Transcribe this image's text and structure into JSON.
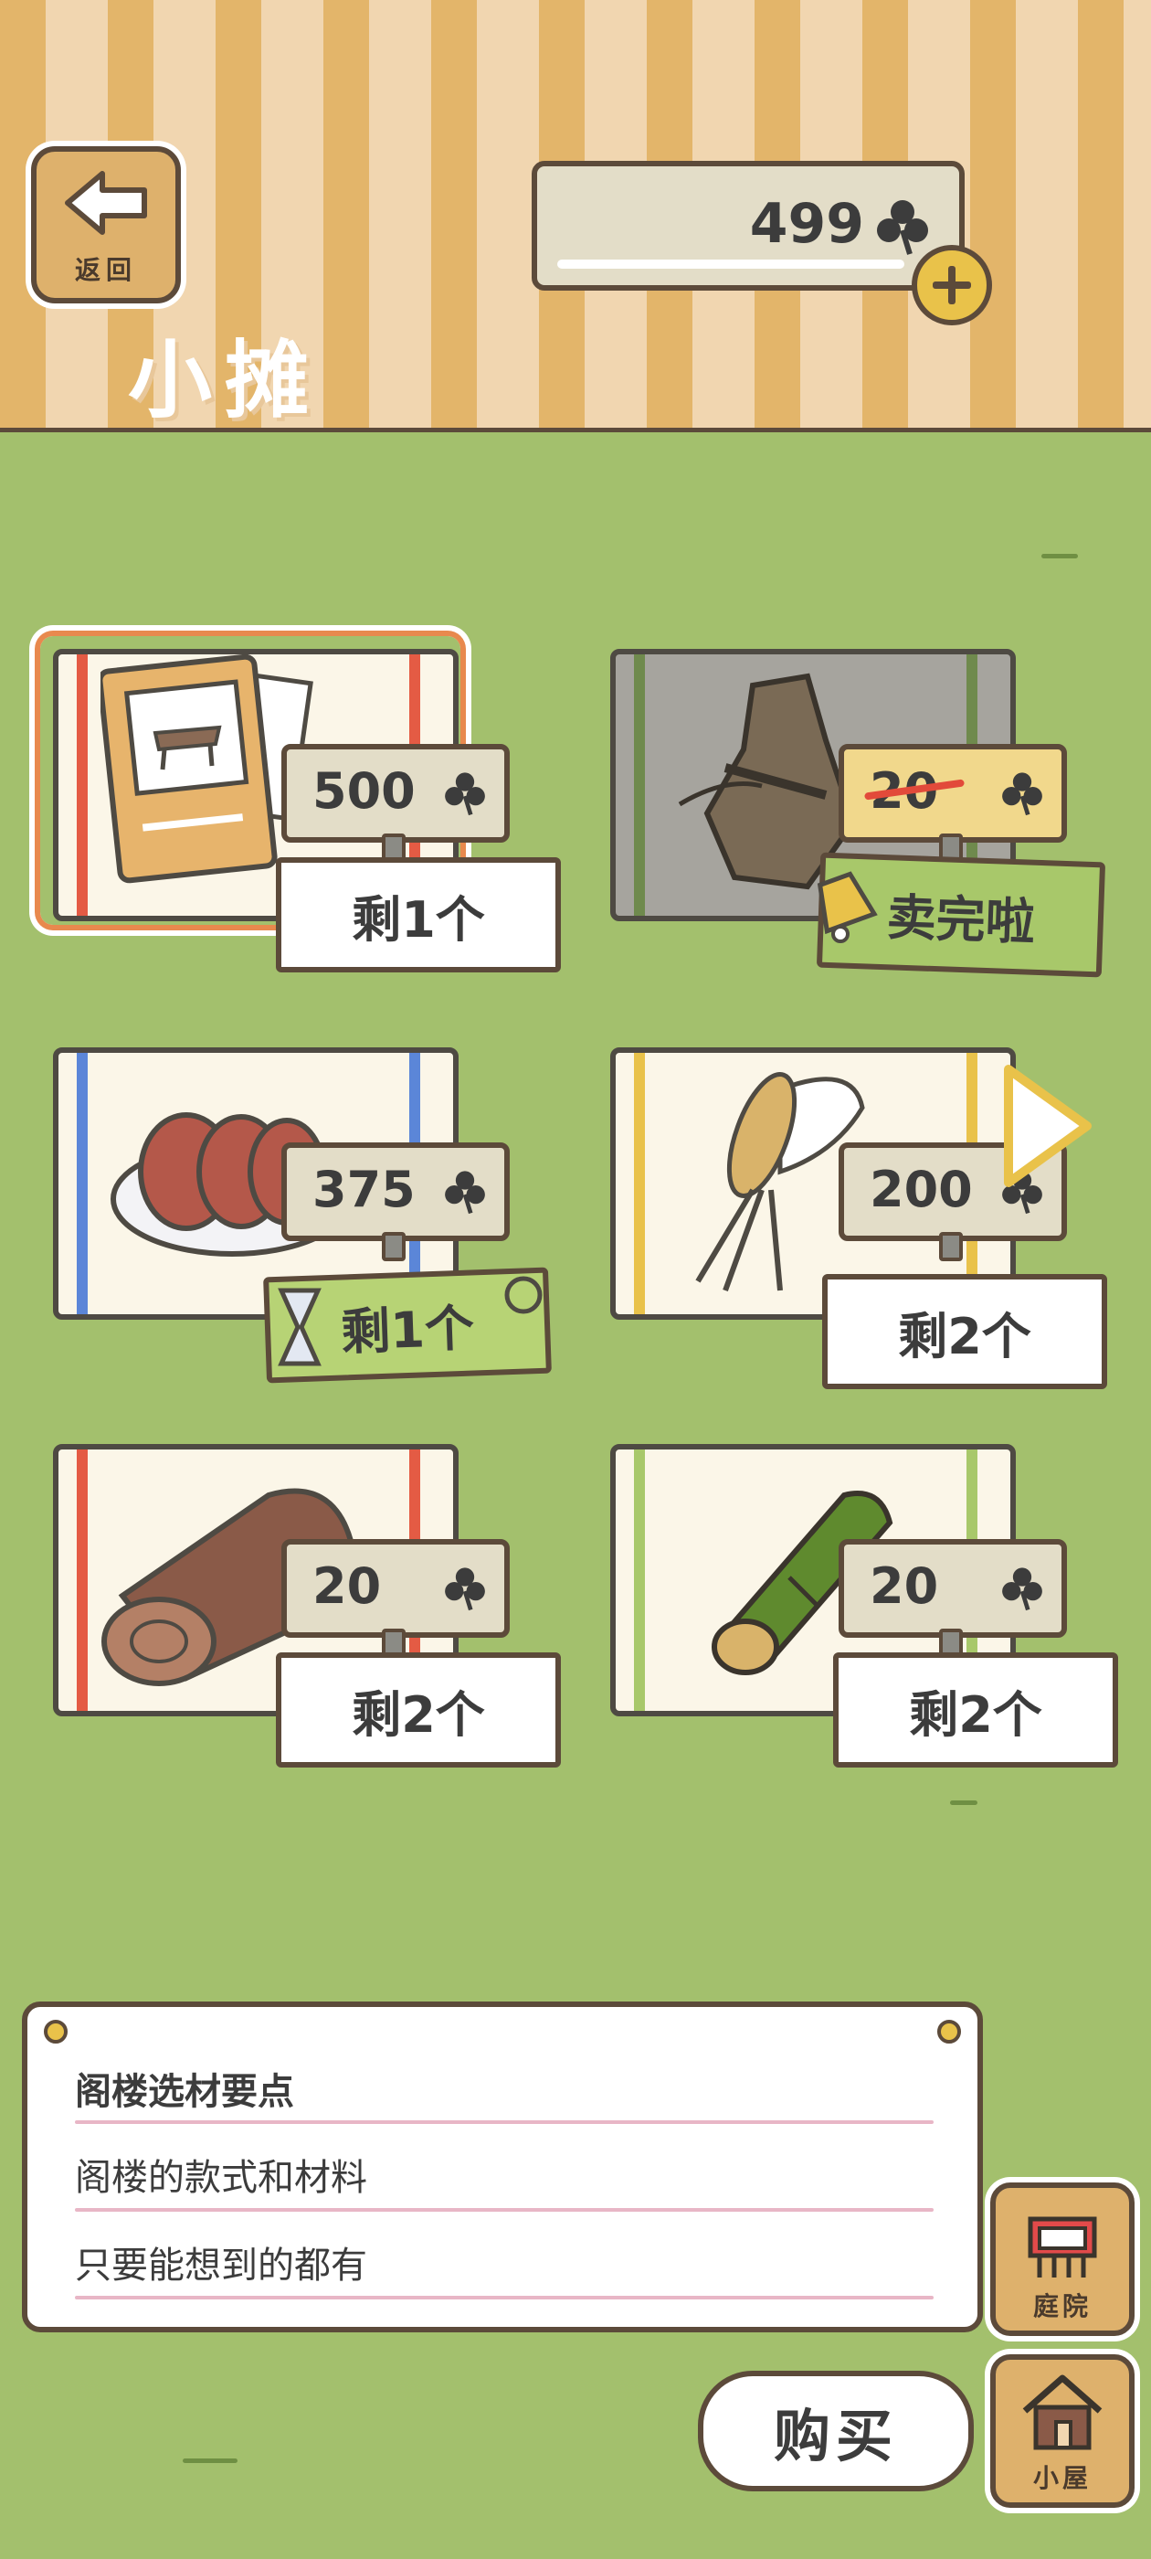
{
  "header": {
    "back_label": "返回",
    "title": "小摊",
    "currency_amount": "499",
    "currency_icon": "clover-icon"
  },
  "items": [
    {
      "price": "500",
      "stock": "剩1个",
      "state": "selected"
    },
    {
      "price": "20",
      "stock": "卖完啦",
      "state": "sold-out"
    },
    {
      "price": "375",
      "stock": "剩1个",
      "state": "limited"
    },
    {
      "price": "200",
      "stock": "剩2个",
      "state": "normal"
    },
    {
      "price": "20",
      "stock": "剩2个",
      "state": "normal"
    },
    {
      "price": "20",
      "stock": "剩2个",
      "state": "normal"
    }
  ],
  "info": {
    "title": "阁楼选材要点",
    "line1": "阁楼的款式和材料",
    "line2": "只要能想到的都有"
  },
  "buttons": {
    "yard": "庭院",
    "house": "小屋",
    "buy": "购买"
  },
  "colors": {
    "grass": "#a3c06d",
    "outline": "#5c4a3a",
    "stripe_tan": "#e3b56a",
    "stripe_cream": "#f1d6b0"
  }
}
